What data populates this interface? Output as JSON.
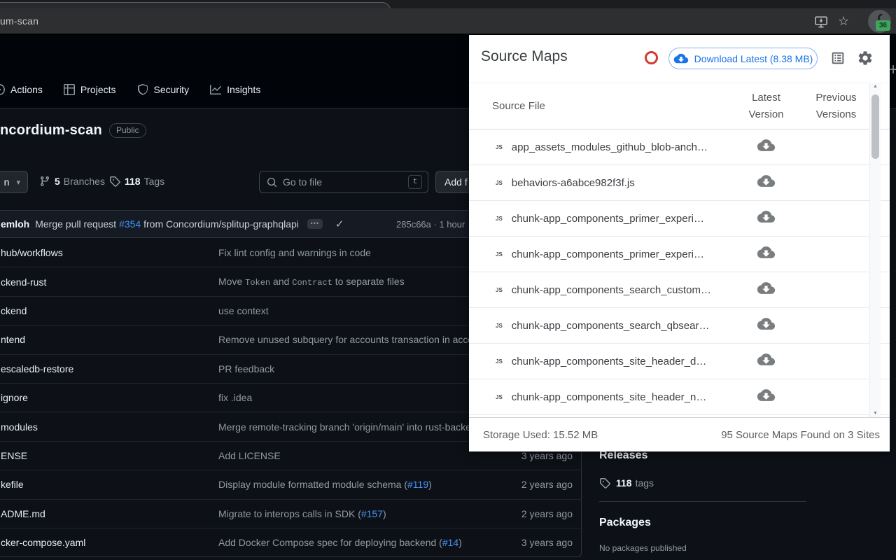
{
  "browser": {
    "url": "um-scan",
    "extension_badge": "36"
  },
  "page": {
    "plus": "+",
    "nav": {
      "items": [
        {
          "label": "Actions"
        },
        {
          "label": "Projects"
        },
        {
          "label": "Security"
        },
        {
          "label": "Insights"
        }
      ]
    },
    "repo": {
      "name": "ncordium-scan",
      "visibility": "Public"
    },
    "toolbar": {
      "branch": "n",
      "branches_count": "5",
      "branches_label": "Branches",
      "tags_count": "118",
      "tags_label": "Tags",
      "goto_placeholder": "Go to file",
      "goto_key": "t",
      "add_file": "Add f"
    },
    "commit": {
      "author": "emloh",
      "msg1": "Merge pull request ",
      "pr": "#354",
      "msg2": " from Concordium/splitup-graphqlapi",
      "ellipsis": "•••",
      "check": "✓",
      "sha": "285c66a",
      "sep": " · ",
      "time": "1 hour"
    },
    "files": [
      {
        "name": "hub/workflows",
        "message": [
          {
            "t": "Fix lint config and warnings in code"
          }
        ],
        "age": ""
      },
      {
        "name": "ckend-rust",
        "message": [
          {
            "t": "Move "
          },
          {
            "t": "Token",
            "s": "code"
          },
          {
            "t": " and "
          },
          {
            "t": "Contract",
            "s": "code"
          },
          {
            "t": " to separate files"
          }
        ],
        "age": ""
      },
      {
        "name": "ckend",
        "message": [
          {
            "t": "use context"
          }
        ],
        "age": ""
      },
      {
        "name": "ntend",
        "message": [
          {
            "t": "Remove unused subquery for accounts transaction in acco"
          }
        ],
        "age": ""
      },
      {
        "name": "escaledb-restore",
        "message": [
          {
            "t": "PR feedback"
          }
        ],
        "age": ""
      },
      {
        "name": "ignore",
        "message": [
          {
            "t": "fix .idea"
          }
        ],
        "age": ""
      },
      {
        "name": "modules",
        "message": [
          {
            "t": "Merge remote-tracking branch 'origin/main' into rust-backe"
          }
        ],
        "age": ""
      },
      {
        "name": "ENSE",
        "message": [
          {
            "t": "Add LICENSE"
          }
        ],
        "age": "3 years ago"
      },
      {
        "name": "kefile",
        "message": [
          {
            "t": "Display module formatted module schema ("
          },
          {
            "t": "#119",
            "s": "link"
          },
          {
            "t": ")"
          }
        ],
        "age": "2 years ago"
      },
      {
        "name": "ADME.md",
        "message": [
          {
            "t": "Migrate to interops calls in SDK ("
          },
          {
            "t": "#157",
            "s": "link"
          },
          {
            "t": ")"
          }
        ],
        "age": "2 years ago"
      },
      {
        "name": "cker-compose.yaml",
        "message": [
          {
            "t": "Add Docker Compose spec for deploying backend ("
          },
          {
            "t": "#14",
            "s": "link"
          },
          {
            "t": ")"
          }
        ],
        "age": "3 years ago"
      }
    ],
    "sidebar": {
      "releases_title": "Releases",
      "tags_count": "118",
      "tags_label": "tags",
      "packages_title": "Packages",
      "packages_empty": "No packages published"
    }
  },
  "popup": {
    "title": "Source Maps",
    "download_label": "Download Latest (8.38 MB)",
    "table": {
      "col_file": "Source File",
      "col_latest": [
        "Latest",
        "Version"
      ],
      "col_previous": [
        "Previous",
        "Versions"
      ]
    },
    "rows": [
      "app_assets_modules_github_blob-anch…",
      "behaviors-a6abce982f3f.js",
      "chunk-app_components_primer_experi…",
      "chunk-app_components_primer_experi…",
      "chunk-app_components_search_custom…",
      "chunk-app_components_search_qbsear…",
      "chunk-app_components_site_header_d…",
      "chunk-app_components_site_header_n…"
    ],
    "footer": {
      "left": "Storage Used: 15.52 MB",
      "right": "95 Source Maps Found on 3 Sites"
    }
  }
}
